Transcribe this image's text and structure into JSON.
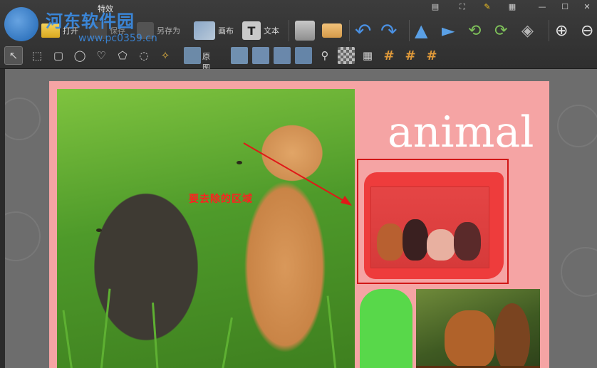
{
  "window": {
    "tab_label": "特效",
    "controls": [
      "minimize",
      "maximize",
      "close"
    ]
  },
  "watermark": {
    "title": "河东软件园",
    "url": "www.pc0359.cn"
  },
  "toolbar": {
    "open_label": "打开",
    "save_label": "保存",
    "save_as_label": "另存为",
    "canvas_label": "画布",
    "text_label": "文本",
    "original_label": "原图"
  },
  "document": {
    "heading": "animal",
    "annotation": "要去除的区域"
  },
  "colors": {
    "doc_background": "#f5a4a4",
    "annotation_red": "#ff2020",
    "selection_red": "#d11717",
    "green_shape": "#58d84a"
  },
  "icons": {
    "selection_tools": [
      "pointer-icon",
      "rect-select-icon",
      "rounded-rect-select-icon",
      "ellipse-select-icon",
      "heart-select-icon",
      "polygon-select-icon",
      "lasso-select-icon",
      "magic-wand-icon"
    ],
    "effect_tools": [
      "brush-icon",
      "brush-2-icon",
      "brush-3-icon",
      "brush-4-icon",
      "eye-dropper-icon",
      "checkerboard-icon",
      "grid-icon",
      "hash-1-icon",
      "hash-2-icon",
      "hash-3-icon"
    ]
  }
}
